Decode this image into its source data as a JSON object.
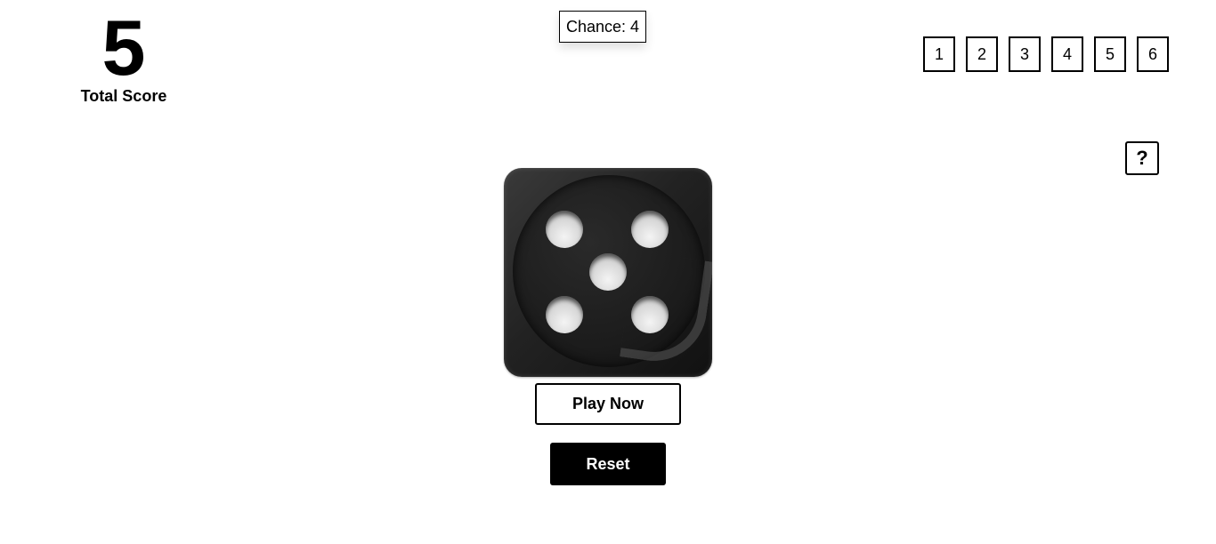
{
  "score": {
    "value": "5",
    "label": "Total Score"
  },
  "chance": {
    "text": "Chance: 4"
  },
  "number_options": [
    "1",
    "2",
    "3",
    "4",
    "5",
    "6"
  ],
  "help": {
    "label": "?"
  },
  "die": {
    "face_value": 5,
    "icon": "die-five-icon"
  },
  "actions": {
    "play_label": "Play Now",
    "reset_label": "Reset"
  },
  "colors": {
    "background": "#ffffff",
    "text": "#000000",
    "die_body": "#222222",
    "pip": "#e6e6e6",
    "reset_bg": "#000000",
    "reset_text": "#ffffff"
  }
}
